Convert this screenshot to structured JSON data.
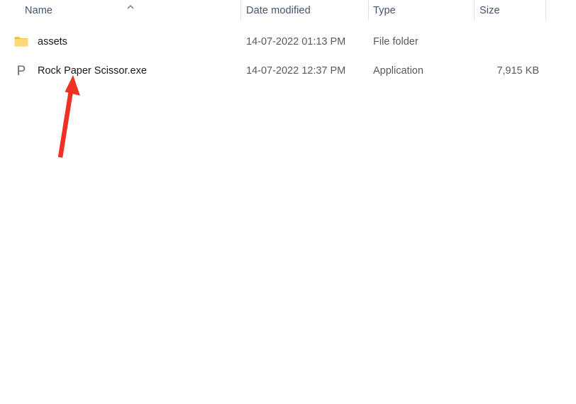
{
  "window": {
    "title": "File Explorer file listing"
  },
  "columns": [
    {
      "key": "name",
      "label": "Name",
      "sort": "ascending"
    },
    {
      "key": "date",
      "label": "Date modified",
      "sort": "none"
    },
    {
      "key": "type",
      "label": "Type",
      "sort": "none"
    },
    {
      "key": "size",
      "label": "Size",
      "sort": "none"
    }
  ],
  "rows": [
    {
      "icon": "folder-icon",
      "name": "assets",
      "date": "14-07-2022 01:13 PM",
      "type": "File folder",
      "size": ""
    },
    {
      "icon": "application-p-icon",
      "name": "Rock Paper Scissor.exe",
      "date": "14-07-2022 12:37 PM",
      "type": "Application",
      "size": "7,915 KB"
    }
  ],
  "annotation": {
    "kind": "arrow",
    "points_to": "Rock Paper Scissor.exe",
    "color": "#ed3124"
  },
  "colors": {
    "background": "#ffffff",
    "header_text": "#44546a",
    "row_primary_text": "#1a1a1a",
    "row_secondary_text": "#5a5a5a",
    "divider": "#e2e2e2",
    "folder_body": "#fcd97a",
    "folder_tab": "#f0b323",
    "exe_glyph": "#6e6e6e",
    "annotation_red": "#ed3124"
  }
}
